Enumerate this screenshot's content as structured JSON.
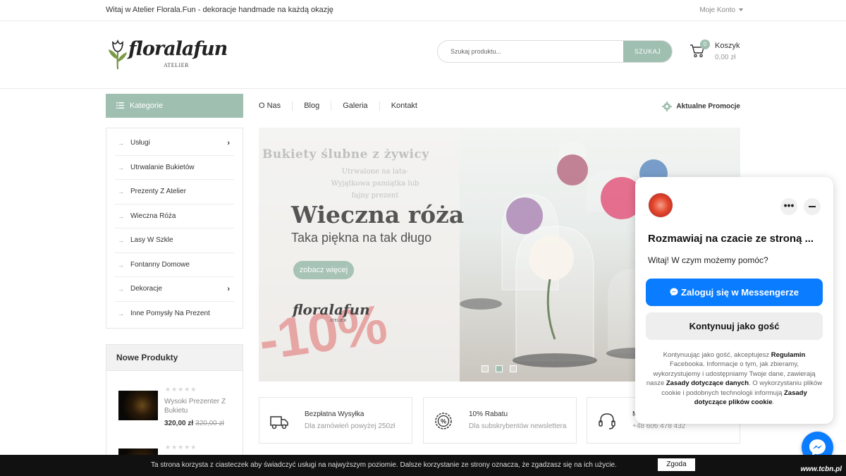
{
  "topbar": {
    "welcome": "Witaj w Atelier Florala.Fun - dekoracje handmade na każdą okazję",
    "account": "Moje Konto"
  },
  "header": {
    "logo_text": "floralafun",
    "logo_sub": "ATELIER",
    "search_placeholder": "Szukaj produktu...",
    "search_button": "SZUKAJ",
    "cart_count": "0",
    "cart_label": "Koszyk",
    "cart_total": "0,00 zł"
  },
  "nav": {
    "categories_label": "Kategorie",
    "items": [
      "O Nas",
      "Blog",
      "Galeria",
      "Kontakt"
    ],
    "promo": "Aktualne Promocje"
  },
  "categories": [
    {
      "label": "Usługi",
      "has_sub": true
    },
    {
      "label": "Utrwalanie Bukietów",
      "has_sub": false
    },
    {
      "label": "Prezenty Z Atelier",
      "has_sub": false
    },
    {
      "label": "Wieczna Róża",
      "has_sub": false
    },
    {
      "label": "Lasy W Szkle",
      "has_sub": false
    },
    {
      "label": "Fontanny Domowe",
      "has_sub": false
    },
    {
      "label": "Dekoracje",
      "has_sub": true
    },
    {
      "label": "Inne Pomysły Na Prezent",
      "has_sub": false
    }
  ],
  "new_products": {
    "title": "Nowe Produkty",
    "items": [
      {
        "name": "Wysoki Prezenter Z Bukietu",
        "price": "320,00 zł",
        "old_price": "320,00 zł",
        "rating": 0
      }
    ]
  },
  "slider": {
    "bg_title": "Bukiety ślubne z żywicy",
    "bg_lines": [
      "Utrwalone na lata-",
      "Wyjątkowa pamiątka lub",
      "fajny prezent"
    ],
    "heading": "Wieczna róża",
    "tagline": "Taka piękna na tak długo",
    "cta": "zobacz więcej",
    "discount": "-10%",
    "logo_text": "floralafun",
    "logo_sub": "ATELIER",
    "active_slide": 2,
    "slide_count": 3
  },
  "info_boxes": [
    {
      "title": "Bezpłatna Wysyłka",
      "desc": "Dla zamówień powyżej 250zł",
      "icon": "truck-icon"
    },
    {
      "title": "10% Rabatu",
      "desc": "Dla subskrybentów newslettera",
      "icon": "discount-icon"
    },
    {
      "title": "M",
      "desc": "+48 606 478 432",
      "icon": "headset-icon"
    }
  ],
  "chat": {
    "title": "Rozmawiaj na czacie ze stroną ...",
    "greeting": "Witaj! W czym możemy pomóc?",
    "messenger_button": "Zaloguj się w Messengerze",
    "guest_button": "Kontynuuj jako gość",
    "legal": {
      "p1": "Kontynuując jako gość, akceptujesz ",
      "l1": "Regulamin",
      "p2": " Facebooka. Informacje o tym, jak zbieramy, wykorzystujemy i udostępniamy Twoje dane, zawierają nasze ",
      "l2": "Zasady dotyczące danych",
      "p3": ". O wykorzystaniu plików cookie i podobnych technologii informują ",
      "l3": "Zasady dotyczące plików cookie",
      "p4": "."
    }
  },
  "cookie": {
    "text": "Ta strona korzysta z ciasteczek aby świadczyć usługi na najwyższym poziomie. Dalsze korzystanie ze strony oznacza, że zgadzasz się na ich użycie.",
    "button": "Zgoda",
    "watermark": "www.tcbn.pl"
  },
  "colors": {
    "accent": "#9fbfb0",
    "messenger": "#0a7cff",
    "cookie_bar": "#111111"
  }
}
